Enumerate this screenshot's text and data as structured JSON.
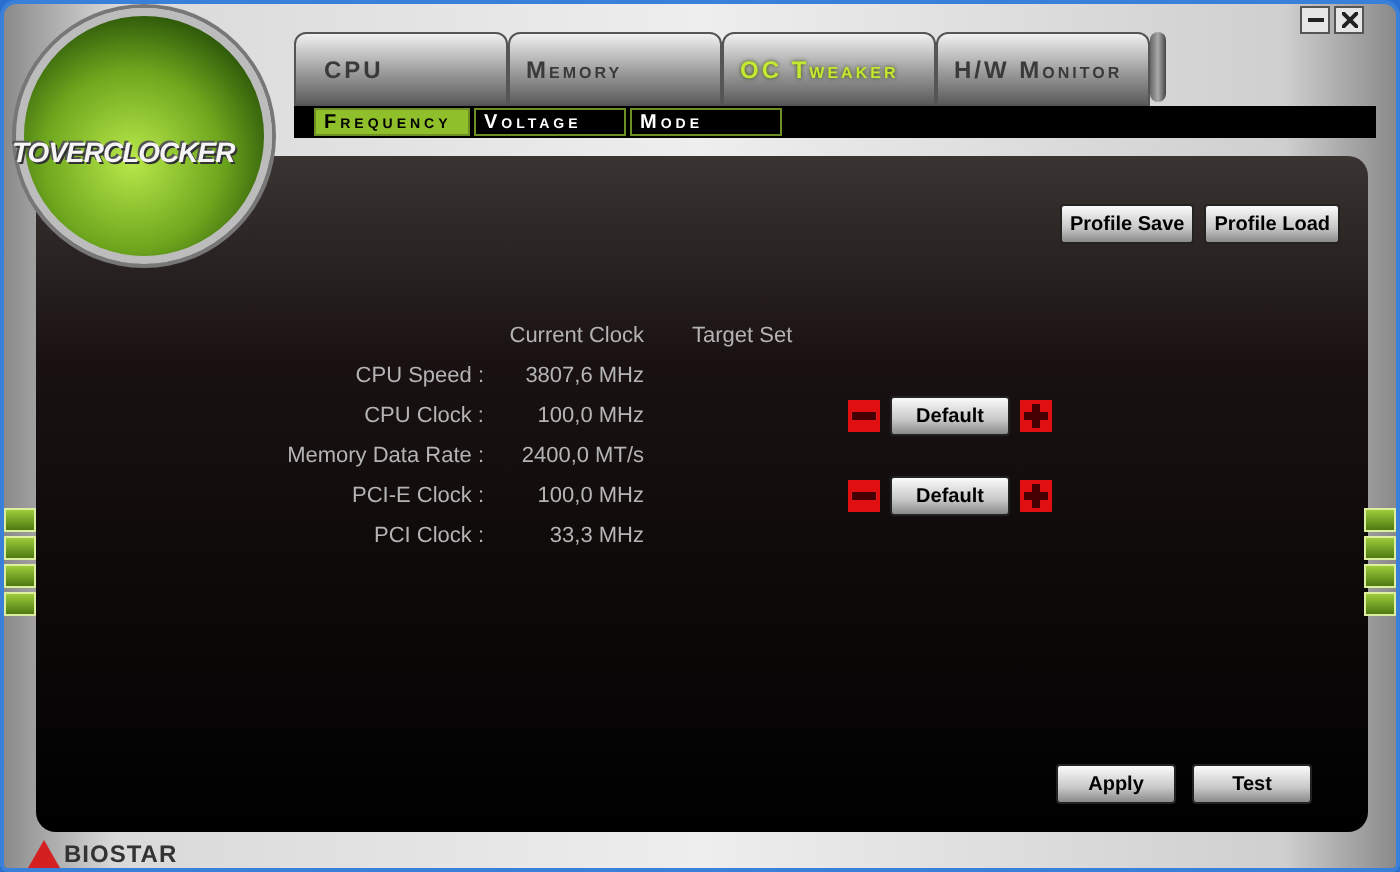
{
  "logo": {
    "text": "TOVERCLOCKER"
  },
  "tabs": [
    {
      "label": "CPU",
      "selected": false
    },
    {
      "label": "Memory",
      "selected": false
    },
    {
      "label": "OC Tweaker",
      "selected": true
    },
    {
      "label": "H/W Monitor",
      "selected": false
    }
  ],
  "subtabs": [
    {
      "label": "Frequency",
      "selected": true
    },
    {
      "label": "Voltage",
      "selected": false
    },
    {
      "label": "Mode",
      "selected": false
    }
  ],
  "profile_buttons": [
    "Profile Save",
    "Profile Load"
  ],
  "table": {
    "columns": [
      "Current Clock",
      "Target Set"
    ],
    "rows": [
      {
        "label": "CPU Speed :",
        "value": "3807,6 MHz",
        "kind": "readonly"
      },
      {
        "label": "CPU Clock :",
        "value": "100,0 MHz",
        "kind": "adjustable",
        "button": "Default"
      },
      {
        "label": "Memory Data Rate :",
        "value": "2400,0 MT/s",
        "kind": "readonly"
      },
      {
        "label": "PCI-E Clock :",
        "value": "100,0 MHz",
        "kind": "adjustable",
        "button": "Default"
      },
      {
        "label": "PCI Clock :",
        "value": "33,3 MHz",
        "kind": "readonly"
      }
    ]
  },
  "action_buttons": [
    "Apply",
    "Test"
  ],
  "brand": {
    "text": "BIOSTAR"
  }
}
